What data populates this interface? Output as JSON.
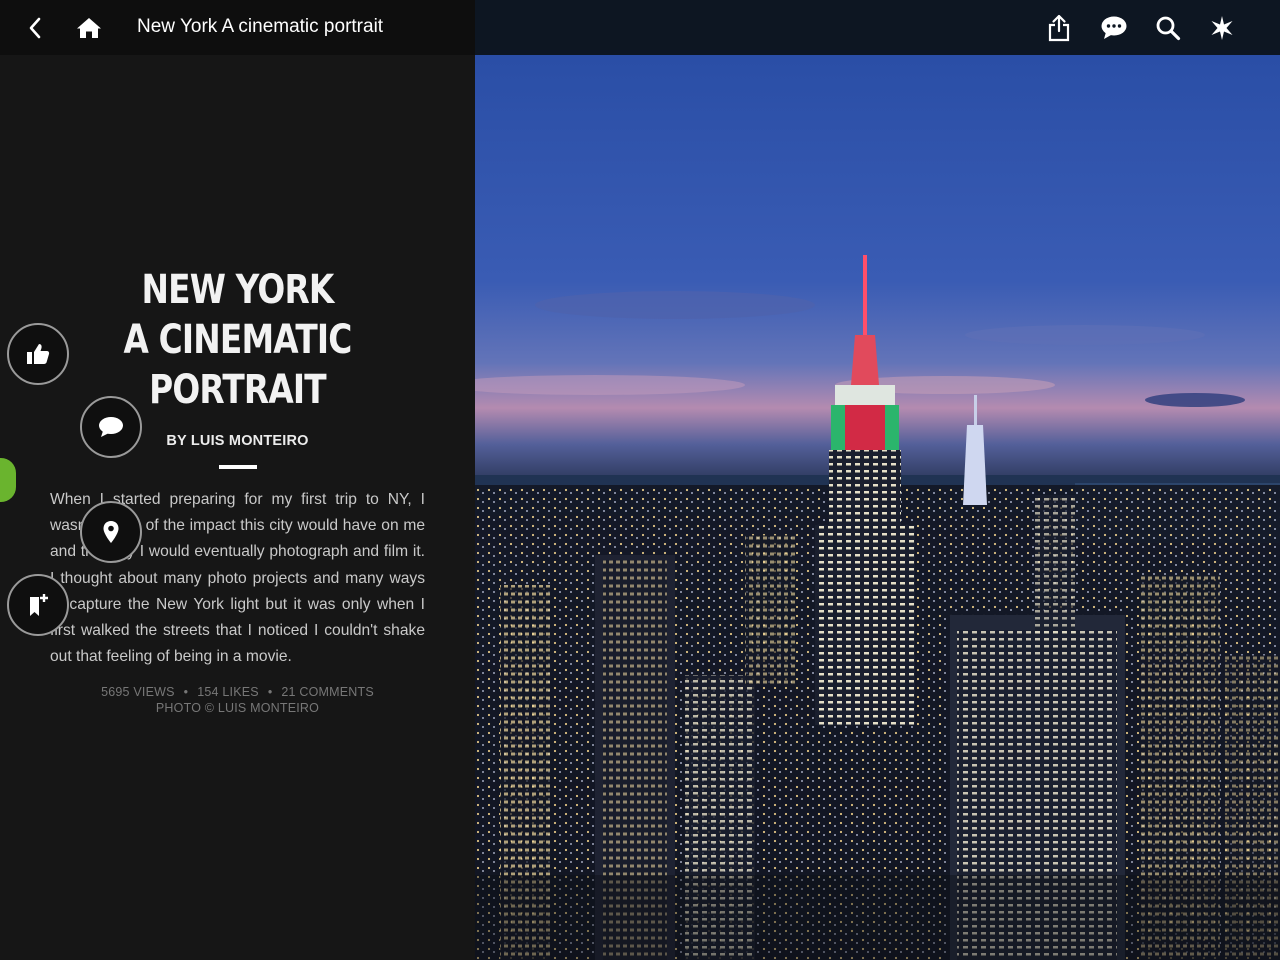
{
  "header": {
    "title": "New York A cinematic portrait",
    "back_icon": "chevron-left-icon",
    "home_icon": "home-icon",
    "right_icons": [
      "share-icon",
      "comment-icon",
      "search-icon",
      "star-icon"
    ]
  },
  "article": {
    "title_line1": "NEW YORK",
    "title_line2": "A CINEMATIC",
    "title_line3": "PORTRAIT",
    "byline": "BY LUIS MONTEIRO",
    "body": "When I started preparing for my first trip to NY, I wasn't aware of the impact this city would have on me and the way I would eventually photograph and film it. I thought about many photo projects and many ways to capture the New York light but it was only when I first walked the streets that I noticed I couldn't shake out that feeling of being in a movie.",
    "views": "5695 VIEWS",
    "likes": "154 LIKES",
    "comments": "21 COMMENTS",
    "credit": "PHOTO © LUIS MONTEIRO",
    "dot": "•"
  },
  "actions": {
    "like_icon": "thumbs-up-icon",
    "comment_icon": "speech-bubble-icon",
    "location_icon": "map-pin-icon",
    "bookmark_icon": "bookmark-add-icon"
  },
  "colors": {
    "accent_green": "#6ab42e",
    "panel_bg": "#161616",
    "sky_top": "#2a4ea6",
    "sky_dusk": "#b48bb0"
  }
}
